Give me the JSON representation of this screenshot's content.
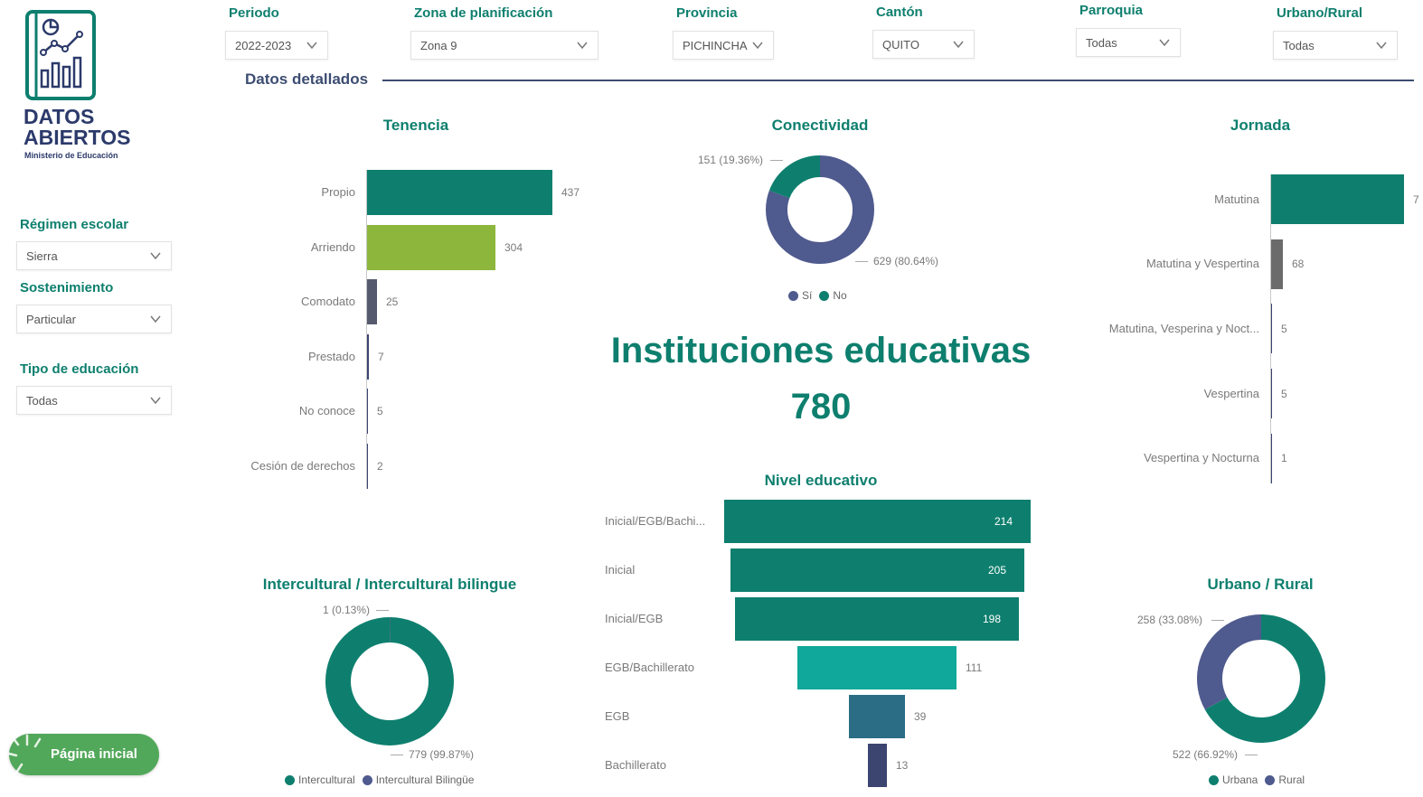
{
  "brand": {
    "line1": "DATOS",
    "line2": "ABIERTOS",
    "sub": "Ministerio de Educación"
  },
  "filters": [
    {
      "label": "Periodo",
      "value": "2022-2023"
    },
    {
      "label": "Zona de planificación",
      "value": "Zona 9"
    },
    {
      "label": "Provincia",
      "value": "PICHINCHA"
    },
    {
      "label": "Cantón",
      "value": "QUITO"
    },
    {
      "label": "Parroquia",
      "value": "Todas"
    },
    {
      "label": "Urbano/Rural",
      "value": "Todas"
    }
  ],
  "sidebar": [
    {
      "label": "Régimen escolar",
      "value": "Sierra"
    },
    {
      "label": "Sostenimiento",
      "value": "Particular"
    },
    {
      "label": "Tipo de educación",
      "value": "Todas"
    }
  ],
  "home_button": "Página inicial",
  "section_title": "Datos detallados",
  "kpi": {
    "title": "Instituciones educativas",
    "value": "780"
  },
  "colors": {
    "teal": "#0e7f6e",
    "green": "#8db63c",
    "navy": "#4f5a8e",
    "gray": "#6b6b6b",
    "light_teal": "#0fa89a",
    "blue_teal": "#2b6d85",
    "dark_navy": "#3c4470"
  },
  "chart_data": [
    {
      "type": "bar",
      "title": "Tenencia",
      "categories": [
        "Propio",
        "Arriendo",
        "Comodato",
        "Prestado",
        "No conoce",
        "Cesión de derechos"
      ],
      "values": [
        437,
        304,
        25,
        7,
        5,
        2
      ],
      "value_labels": [
        "437",
        "304",
        "25",
        "7",
        "5",
        "2"
      ],
      "colors": [
        "#0e7f6e",
        "#8db63c",
        "#555a6e",
        "#3c4470",
        "#3c4470",
        "#3c4470"
      ]
    },
    {
      "type": "pie",
      "title": "Conectividad",
      "series": [
        {
          "name": "Sí",
          "value": 629,
          "label": "629 (80.64%)",
          "color": "#4f5a8e"
        },
        {
          "name": "No",
          "value": 151,
          "label": "151 (19.36%)",
          "color": "#0e7f6e"
        }
      ]
    },
    {
      "type": "bar",
      "title": "Jornada",
      "categories": [
        "Matutina",
        "Matutina y Vespertina",
        "Matutina, Vesperina y Noct...",
        "Vespertina",
        "Vespertina y Nocturna"
      ],
      "values": [
        701,
        68,
        5,
        5,
        1
      ],
      "value_labels": [
        "7",
        "68",
        "5",
        "5",
        "1"
      ],
      "colors": [
        "#0e7f6e",
        "#6b6b6b",
        "#3c4470",
        "#3c4470",
        "#3c4470"
      ]
    },
    {
      "type": "bar",
      "title": "Nivel educativo",
      "categories": [
        "Inicial/EGB/Bachi...",
        "Inicial",
        "Inicial/EGB",
        "EGB/Bachillerato",
        "EGB",
        "Bachillerato"
      ],
      "values": [
        214,
        205,
        198,
        111,
        39,
        13
      ],
      "value_labels": [
        "214",
        "205",
        "198",
        "111",
        "39",
        "13"
      ],
      "colors": [
        "#0e7f6e",
        "#0e7f6e",
        "#0e7f6e",
        "#0fa89a",
        "#2b6d85",
        "#3c4470"
      ]
    },
    {
      "type": "pie",
      "title": "Intercultural / Intercultural bilingue",
      "series": [
        {
          "name": "Intercultural",
          "value": 779,
          "label": "779 (99.87%)",
          "color": "#0e7f6e"
        },
        {
          "name": "Intercultural Bilingüe",
          "value": 1,
          "label": "1 (0.13%)",
          "color": "#4f5a8e"
        }
      ]
    },
    {
      "type": "pie",
      "title": "Urbano / Rural",
      "series": [
        {
          "name": "Urbana",
          "value": 522,
          "label": "522 (66.92%)",
          "color": "#0e7f6e"
        },
        {
          "name": "Rural",
          "value": 258,
          "label": "258 (33.08%)",
          "color": "#4f5a8e"
        }
      ]
    }
  ]
}
